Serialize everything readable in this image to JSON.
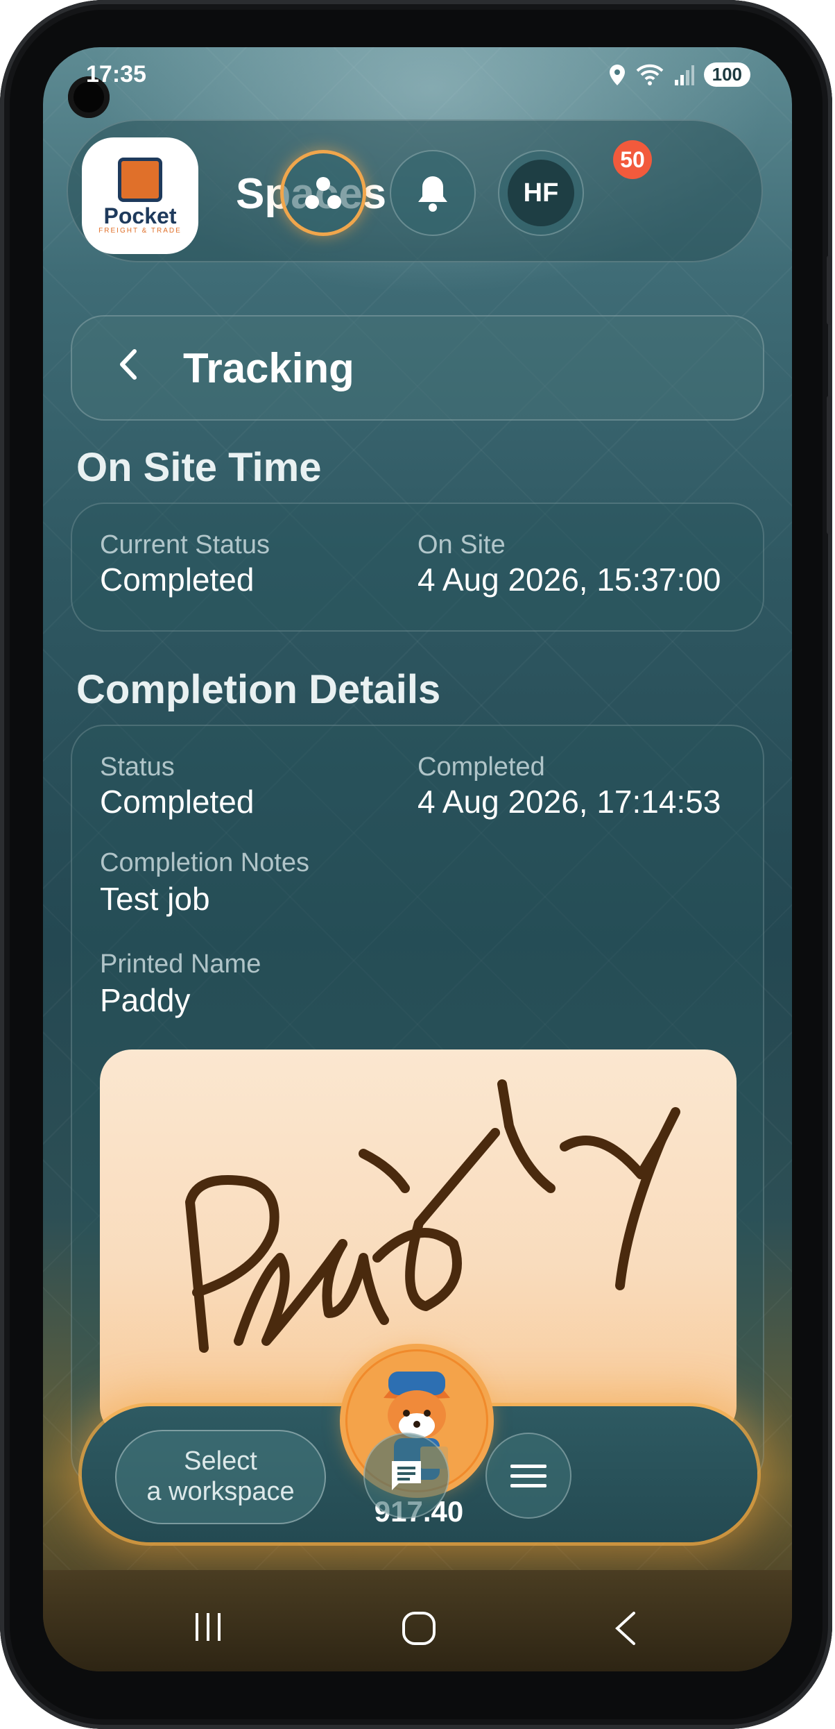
{
  "status_bar": {
    "time": "17:35",
    "battery": "100",
    "network": "5"
  },
  "header": {
    "logo_text": "Pocket",
    "logo_subtext": "FREIGHT & TRADE",
    "title": "Spaces",
    "notifications_count": "50",
    "avatar_initials": "HF"
  },
  "tracking": {
    "title": "Tracking"
  },
  "on_site": {
    "section_title": "On Site Time",
    "current_status_label": "Current Status",
    "current_status_value": "Completed",
    "on_site_label": "On Site",
    "on_site_value": "4 Aug 2026, 15:37:00"
  },
  "completion": {
    "section_title": "Completion Details",
    "status_label": "Status",
    "status_value": "Completed",
    "completed_label": "Completed",
    "completed_value": "4 Aug 2026, 17:14:53",
    "notes_label": "Completion Notes",
    "notes_value": "Test job",
    "printed_name_label": "Printed Name",
    "printed_name_value": "Paddy",
    "signature_text": "Paddy"
  },
  "bottom_nav": {
    "workspace_label": "Select\na workspace",
    "balance": "917.40"
  },
  "colors": {
    "accent": "#f0a64c",
    "badge": "#f25a3c",
    "signature_ink": "#4a2a0e"
  },
  "icons": [
    "groups-icon",
    "bell-icon",
    "back-chevron-icon",
    "chat-icon",
    "menu-icon",
    "recents-icon",
    "home-icon",
    "back-icon"
  ]
}
